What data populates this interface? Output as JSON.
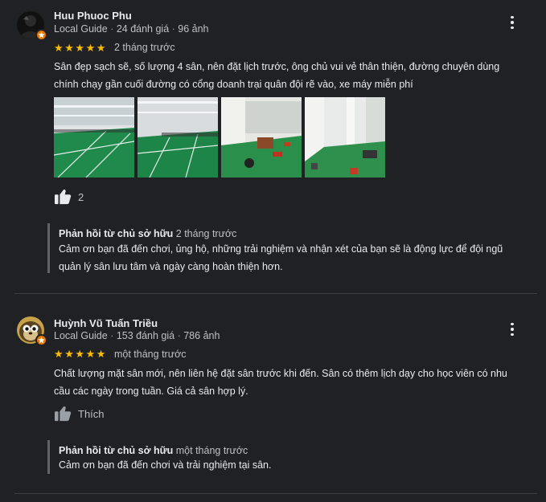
{
  "reviews": [
    {
      "name": "Huu Phuoc Phu",
      "role": "Local Guide",
      "reviews_count": "24 đánh giá",
      "photos_count": "96 ảnh",
      "rating": 5,
      "stars_display": "★★★★★",
      "time": "2 tháng trước",
      "text_lines": [
        "Sân đẹp sạch sẽ, số lượng 4 sân, nên đặt lịch trước, ông chủ vui vẻ thân thiện, đường chuyên dùng",
        "chính chạy gần cuối đường có cổng doanh trại quân đội rẽ vào, xe máy miễn phí"
      ],
      "like_count": "2",
      "reply": {
        "title": "Phản hồi từ chủ sở hữu",
        "time": "2 tháng trước",
        "text_lines": [
          "Cảm ơn bạn đã đến chơi, ủng hộ, những trải nghiệm và nhận xét của bạn sẽ là động lực để đội ngũ",
          "quản lý sân lưu tâm và ngày càng hoàn thiện hơn."
        ]
      }
    },
    {
      "name": "Huỳnh Vũ Tuấn Triều",
      "role": "Local Guide",
      "reviews_count": "153 đánh giá",
      "photos_count": "786 ảnh",
      "rating": 5,
      "stars_display": "★★★★★",
      "time": "một tháng trước",
      "text_lines": [
        "Chất lượng mặt sân mới, nên liên hệ đặt sân trước khi đến. Sân có thêm lịch dạy cho học viên có nhu",
        "cầu các ngày trong tuần. Giá cả sân hợp lý."
      ],
      "like_label": "Thích",
      "reply": {
        "title": "Phản hồi từ chủ sở hữu",
        "time": "một tháng trước",
        "text_lines": [
          "Cảm ơn bạn đã đến chơi và trải nghiệm tại sân."
        ]
      }
    }
  ],
  "separator": " · ",
  "colors": {
    "background": "#202124",
    "star": "#fbbc04",
    "local_guide_badge": "#e37400",
    "court_green": "#1f8a4c"
  },
  "icons": {
    "more": "more-vert-icon",
    "like": "thumb-up-icon",
    "badge": "local-guide-star-icon"
  }
}
